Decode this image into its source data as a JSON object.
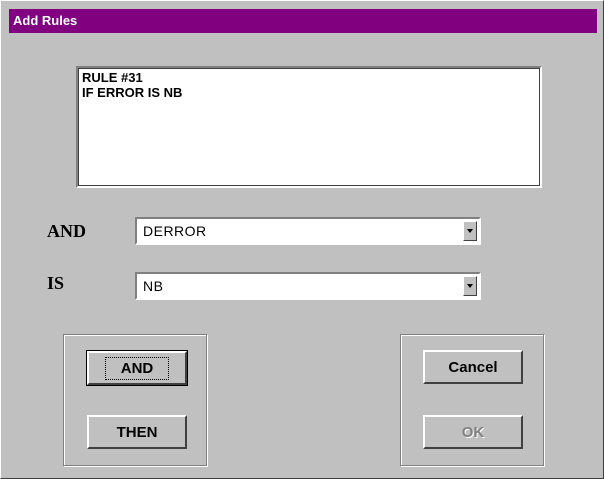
{
  "window": {
    "title": "Add Rules"
  },
  "rule_text": {
    "line1": "RULE #31",
    "line2": "IF ERROR IS NB"
  },
  "conditions": {
    "and_label": "AND",
    "and_value": "DERROR",
    "is_label": "IS",
    "is_value": "NB"
  },
  "buttons": {
    "and": "AND",
    "then": "THEN",
    "cancel": "Cancel",
    "ok": "OK"
  },
  "colors": {
    "titlebar": "#800080",
    "face": "#c0c0c0"
  }
}
